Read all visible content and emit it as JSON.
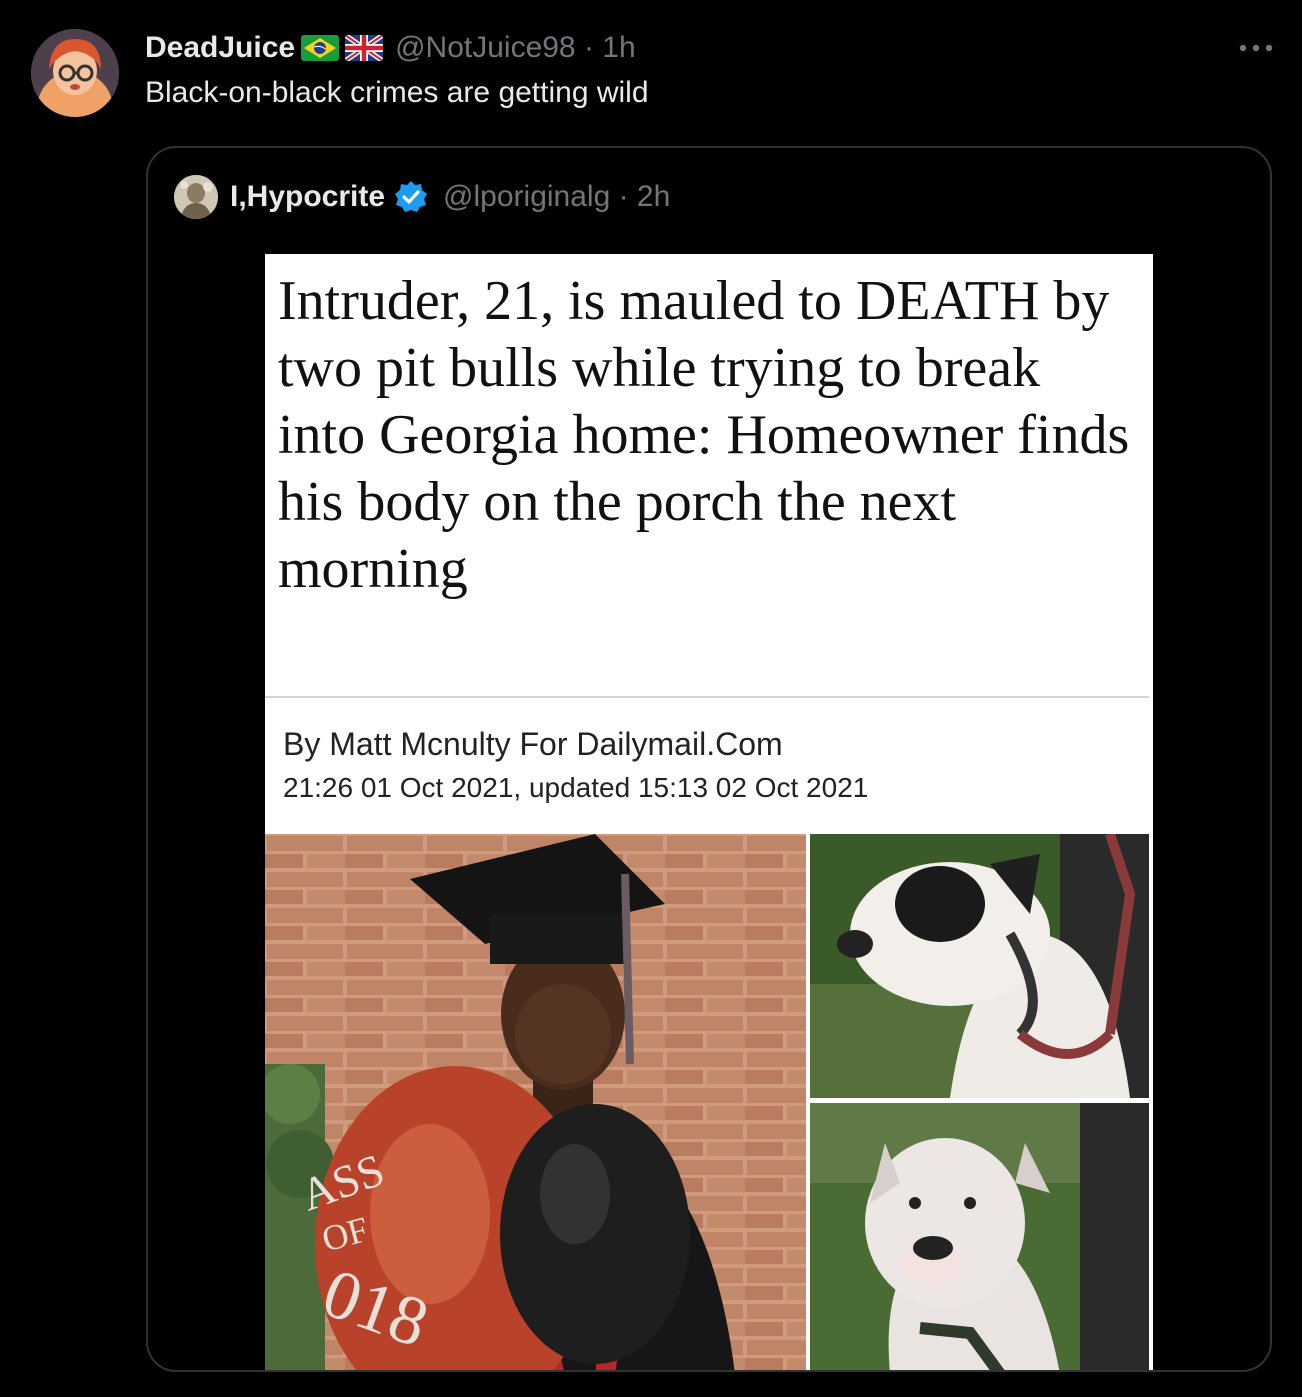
{
  "tweet": {
    "display_name": "DeadJuice",
    "flags": [
      "brazil-flag-icon",
      "uk-flag-icon"
    ],
    "handle_time": "@NotJuice98 · 1h",
    "more_icon": "more-icon",
    "text": "Black-on-black crimes are getting wild"
  },
  "quote": {
    "display_name": "I,Hypocrite",
    "verified_icon": "verified-badge-icon",
    "handle_time": "@lporiginalg · 2h",
    "article": {
      "headline": "Intruder, 21, is mauled to DEATH by two pit bulls while trying to break into Georgia home: Homeowner finds his body on the porch the next morning",
      "byline": "By Matt Mcnulty For Dailymail.Com",
      "dateline": "21:26 01 Oct 2021, updated 15:13 02 Oct 2021",
      "balloon_text_1": "ASS",
      "balloon_text_2": "OF",
      "balloon_text_3": "018"
    }
  },
  "colors": {
    "background": "#000000",
    "text_primary": "#e7e9ea",
    "text_secondary": "#71767b",
    "border": "#2f3336",
    "verified_blue": "#1d9bf0"
  }
}
